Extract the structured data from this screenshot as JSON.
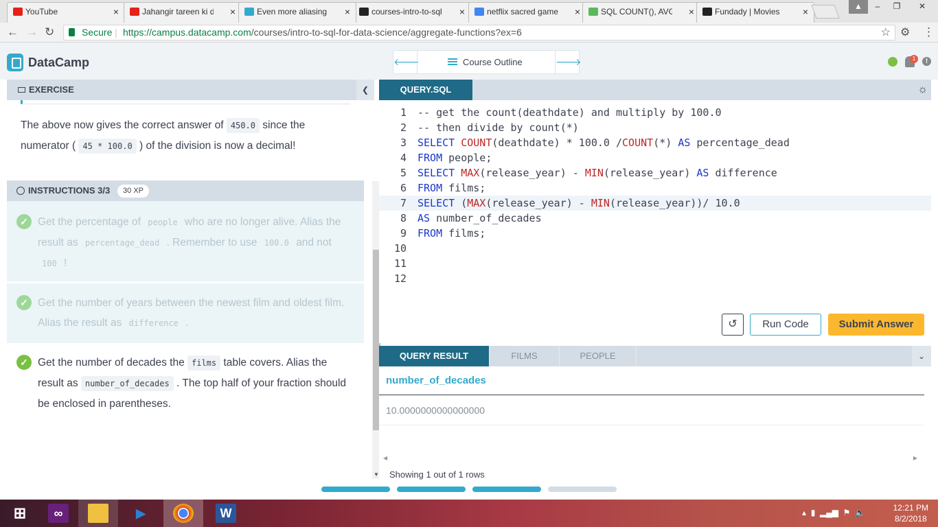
{
  "browser": {
    "tabs": [
      {
        "title": "YouTube",
        "color": "#e62117"
      },
      {
        "title": "Jahangir tareen ki di",
        "color": "#e62117"
      },
      {
        "title": "Even more aliasing |",
        "color": "#33aacc"
      },
      {
        "title": "courses-intro-to-sql",
        "color": "#222222"
      },
      {
        "title": "netflix sacred games",
        "color": "#4285f4"
      },
      {
        "title": "SQL COUNT(), AVG(",
        "color": "#5cb85c"
      },
      {
        "title": "Fundady | Movies",
        "color": "#222222"
      }
    ],
    "close_glyph": "×",
    "secure_label": "Secure",
    "url_host": "https://campus.datacamp.com",
    "url_path": "/courses/intro-to-sql-for-data-science/aggregate-functions?ex=6"
  },
  "header": {
    "brand": "DataCamp",
    "course_outline": "Course Outline",
    "notification_count": "1"
  },
  "exercise": {
    "heading": "EXERCISE",
    "para_before": "The above now gives the correct answer of ",
    "code1": "450.0",
    "para_mid": " since the numerator ( ",
    "code2": "45 * 100.0",
    "para_after": " ) of the division is now a decimal!"
  },
  "instructions": {
    "heading": "INSTRUCTIONS 3/3",
    "xp": "30 XP",
    "steps": [
      {
        "t1": "Get the percentage of ",
        "c1": "people",
        "t2": " who are no longer alive. Alias the result as ",
        "c2": "percentage_dead",
        "t3": " . Remember to use ",
        "c3": "100.0",
        "t4": " and not ",
        "c4": "100",
        "t5": " !"
      },
      {
        "t1": "Get the number of years between the newest film and oldest film. Alias the result as ",
        "c1": "difference",
        "t2": " ."
      },
      {
        "t1": "Get the number of decades the ",
        "c1": "films",
        "t2": " table covers. Alias the result as ",
        "c2": "number_of_decades",
        "t3": " . The top half of your fraction should be enclosed in parentheses."
      }
    ]
  },
  "editor": {
    "tab": "QUERY.SQL",
    "lines": [
      "-- get the count(deathdate) and multiply by 100.0",
      "-- then divide by count(*)",
      "SELECT COUNT(deathdate) * 100.0 /COUNT(*) AS percentage_dead",
      "FROM people;",
      "SELECT MAX(release_year) - MIN(release_year) AS difference",
      "FROM films;",
      "SELECT (MAX(release_year) - MIN(release_year))/ 10.0",
      "AS number_of_decades",
      "FROM films;",
      "",
      "",
      ""
    ],
    "active_line": 7,
    "run_label": "Run Code",
    "submit_label": "Submit Answer"
  },
  "result": {
    "tabs": [
      "QUERY RESULT",
      "FILMS",
      "PEOPLE"
    ],
    "column": "number_of_decades",
    "value": "10.0000000000000000",
    "status": "Showing 1 out of 1 rows"
  },
  "progress": {
    "completed": 3,
    "total": 4,
    "done_color": "#33aacc",
    "todo_color": "#d4dde5"
  },
  "taskbar": {
    "apps": [
      "windows-start",
      "visual-studio",
      "file-explorer",
      "vs-code",
      "chrome",
      "word"
    ],
    "time": "12:21 PM",
    "date": "8/2/2018"
  }
}
